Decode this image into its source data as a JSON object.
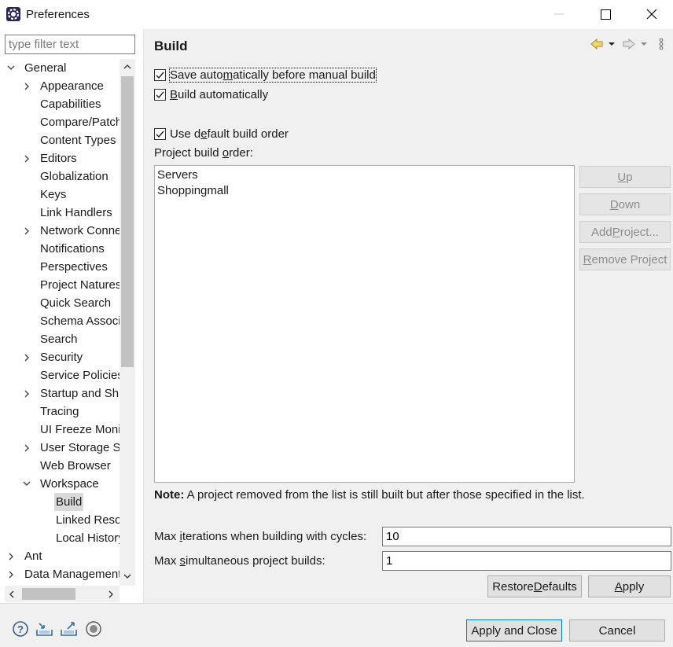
{
  "window": {
    "title": "Preferences",
    "app_icon": "eclipse-gear-icon",
    "controls": [
      "minimize-icon",
      "maximize-icon",
      "close-icon"
    ]
  },
  "left_pane": {
    "filter_placeholder": "type filter text",
    "tree": [
      {
        "label": "General",
        "level": 0,
        "expander": "expanded"
      },
      {
        "label": "Appearance",
        "level": 1,
        "expander": "collapsed"
      },
      {
        "label": "Capabilities",
        "level": 1,
        "expander": "none"
      },
      {
        "label": "Compare/Patch",
        "level": 1,
        "expander": "none"
      },
      {
        "label": "Content Types",
        "level": 1,
        "expander": "none"
      },
      {
        "label": "Editors",
        "level": 1,
        "expander": "collapsed"
      },
      {
        "label": "Globalization",
        "level": 1,
        "expander": "none"
      },
      {
        "label": "Keys",
        "level": 1,
        "expander": "none"
      },
      {
        "label": "Link Handlers",
        "level": 1,
        "expander": "none"
      },
      {
        "label": "Network Connections",
        "level": 1,
        "expander": "collapsed"
      },
      {
        "label": "Notifications",
        "level": 1,
        "expander": "none"
      },
      {
        "label": "Perspectives",
        "level": 1,
        "expander": "none"
      },
      {
        "label": "Project Natures",
        "level": 1,
        "expander": "none"
      },
      {
        "label": "Quick Search",
        "level": 1,
        "expander": "none"
      },
      {
        "label": "Schema Associations",
        "level": 1,
        "expander": "none"
      },
      {
        "label": "Search",
        "level": 1,
        "expander": "none"
      },
      {
        "label": "Security",
        "level": 1,
        "expander": "collapsed"
      },
      {
        "label": "Service Policies",
        "level": 1,
        "expander": "none"
      },
      {
        "label": "Startup and Shutdown",
        "level": 1,
        "expander": "collapsed"
      },
      {
        "label": "Tracing",
        "level": 1,
        "expander": "none"
      },
      {
        "label": "UI Freeze Monitoring",
        "level": 1,
        "expander": "none"
      },
      {
        "label": "User Storage Service",
        "level": 1,
        "expander": "collapsed"
      },
      {
        "label": "Web Browser",
        "level": 1,
        "expander": "none"
      },
      {
        "label": "Workspace",
        "level": 1,
        "expander": "expanded"
      },
      {
        "label": "Build",
        "level": 2,
        "expander": "none",
        "selected": true
      },
      {
        "label": "Linked Resources",
        "level": 2,
        "expander": "none"
      },
      {
        "label": "Local History",
        "level": 2,
        "expander": "none"
      },
      {
        "label": "Ant",
        "level": 0,
        "expander": "collapsed"
      },
      {
        "label": "Data Management",
        "level": 0,
        "expander": "collapsed"
      }
    ]
  },
  "page": {
    "title": "Build",
    "nav_icons": [
      "back-arrow-icon",
      "back-menu-icon",
      "forward-arrow-icon",
      "forward-menu-icon",
      "view-menu-icon"
    ],
    "save_auto": {
      "pre": "Save auto",
      "mn": "m",
      "post": "atically before manual build",
      "checked": true
    },
    "build_auto": {
      "pre": "",
      "mn": "B",
      "post": "uild automatically",
      "checked": true
    },
    "default_order": {
      "pre": "Use d",
      "mn": "e",
      "post": "fault build order",
      "checked": true
    },
    "order_label": {
      "pre": "Project build ",
      "mn": "o",
      "post": "rder:"
    },
    "projects": [
      "Servers",
      "Shoppingmall"
    ],
    "buttons": {
      "up": {
        "mn": "U",
        "post": "p"
      },
      "down": {
        "mn": "D",
        "post": "own"
      },
      "add": {
        "pre": "Add ",
        "mn": "P",
        "post": "roject..."
      },
      "remove": {
        "pre": "",
        "mn": "R",
        "post": "emove Project"
      }
    },
    "note_bold": "Note:",
    "note_text": " A project removed from the list is still built but after those specified in the list.",
    "max_iter": {
      "pre": "Max ",
      "mn": "i",
      "post": "terations when building with cycles:",
      "value": "10"
    },
    "max_sim": {
      "pre": "Max ",
      "mn": "s",
      "post": "imultaneous project builds:",
      "value": "1"
    },
    "restore": {
      "pre": "Restore ",
      "mn": "D",
      "post": "efaults"
    },
    "apply": {
      "pre": "",
      "mn": "A",
      "post": "pply"
    }
  },
  "bottom": {
    "icons": [
      "help-icon",
      "import-icon",
      "export-icon",
      "record-icon"
    ],
    "apply_close": "Apply and Close",
    "cancel": "Cancel"
  }
}
